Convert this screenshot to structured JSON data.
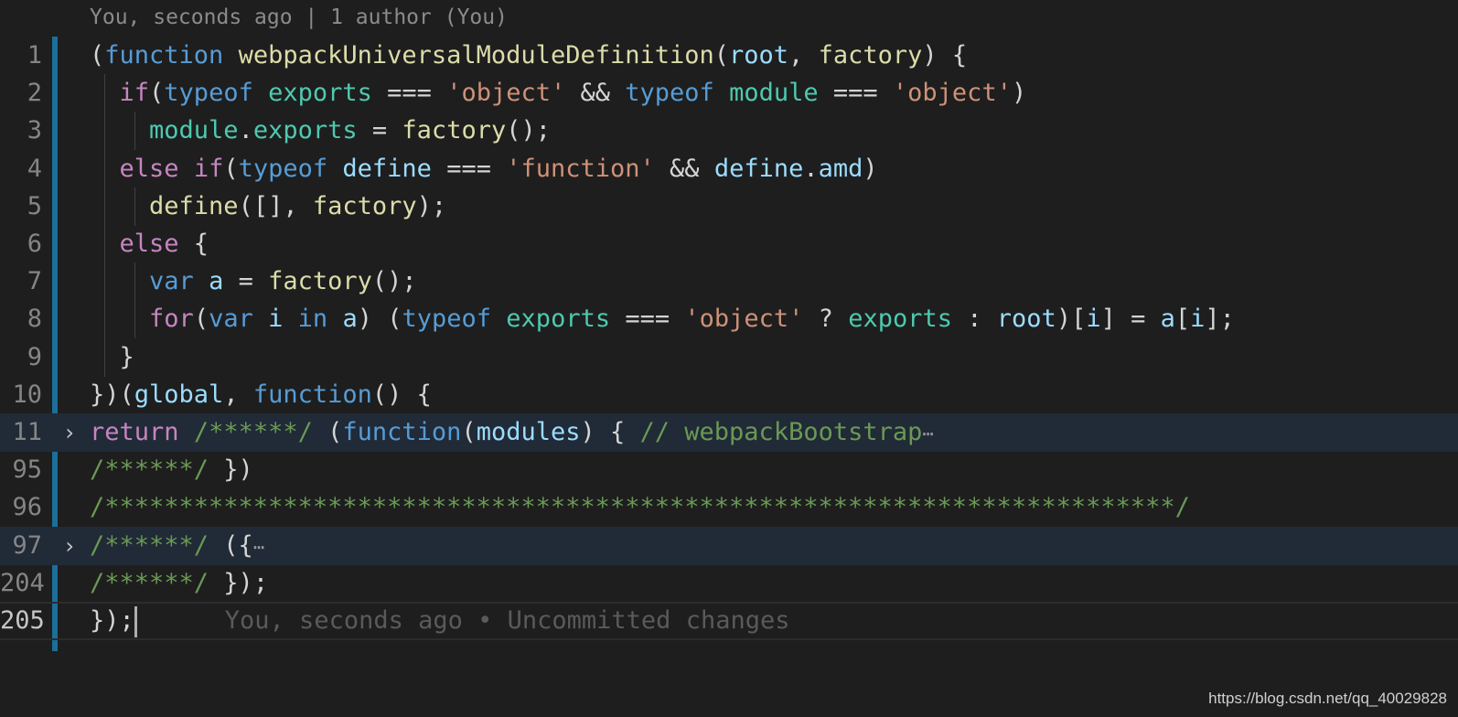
{
  "colors": {
    "background": "#1e1e1e",
    "keyword_blue": "#569cd6",
    "keyword_purple": "#c586c0",
    "function_yellow": "#dcdcaa",
    "variable_light": "#9cdcfe",
    "builtin_teal": "#4ec9b0",
    "string_orange": "#ce9178",
    "comment_green": "#6a9955",
    "default_text": "#d4d4d4",
    "gutter_modified": "#1b6f99"
  },
  "editor": {
    "blame_header": "You, seconds ago | 1 author (You)",
    "inline_blame": "You, seconds ago • Uncommitted changes",
    "watermark": "https://blog.csdn.net/qq_40029828"
  },
  "lines": [
    {
      "num": "1",
      "tokens": [
        {
          "t": "(",
          "c": "default_text"
        },
        {
          "t": "function",
          "c": "keyword_blue"
        },
        {
          "t": " ",
          "c": "default_text"
        },
        {
          "t": "webpackUniversalModuleDefinition",
          "c": "function_yellow"
        },
        {
          "t": "(",
          "c": "default_text"
        },
        {
          "t": "root",
          "c": "variable_light"
        },
        {
          "t": ", ",
          "c": "default_text"
        },
        {
          "t": "factory",
          "c": "function_yellow"
        },
        {
          "t": ") {",
          "c": "default_text"
        }
      ]
    },
    {
      "num": "2",
      "tokens": [
        {
          "t": "  ",
          "c": "default_text"
        },
        {
          "t": "if",
          "c": "keyword_purple"
        },
        {
          "t": "(",
          "c": "default_text"
        },
        {
          "t": "typeof",
          "c": "keyword_blue"
        },
        {
          "t": " ",
          "c": "default_text"
        },
        {
          "t": "exports",
          "c": "builtin_teal"
        },
        {
          "t": " === ",
          "c": "default_text"
        },
        {
          "t": "'object'",
          "c": "string_orange"
        },
        {
          "t": " && ",
          "c": "default_text"
        },
        {
          "t": "typeof",
          "c": "keyword_blue"
        },
        {
          "t": " ",
          "c": "default_text"
        },
        {
          "t": "module",
          "c": "builtin_teal"
        },
        {
          "t": " === ",
          "c": "default_text"
        },
        {
          "t": "'object'",
          "c": "string_orange"
        },
        {
          "t": ")",
          "c": "default_text"
        }
      ]
    },
    {
      "num": "3",
      "tokens": [
        {
          "t": "    ",
          "c": "default_text"
        },
        {
          "t": "module",
          "c": "builtin_teal"
        },
        {
          "t": ".",
          "c": "default_text"
        },
        {
          "t": "exports",
          "c": "builtin_teal"
        },
        {
          "t": " = ",
          "c": "default_text"
        },
        {
          "t": "factory",
          "c": "function_yellow"
        },
        {
          "t": "();",
          "c": "default_text"
        }
      ]
    },
    {
      "num": "4",
      "tokens": [
        {
          "t": "  ",
          "c": "default_text"
        },
        {
          "t": "else",
          "c": "keyword_purple"
        },
        {
          "t": " ",
          "c": "default_text"
        },
        {
          "t": "if",
          "c": "keyword_purple"
        },
        {
          "t": "(",
          "c": "default_text"
        },
        {
          "t": "typeof",
          "c": "keyword_blue"
        },
        {
          "t": " ",
          "c": "default_text"
        },
        {
          "t": "define",
          "c": "variable_light"
        },
        {
          "t": " === ",
          "c": "default_text"
        },
        {
          "t": "'function'",
          "c": "string_orange"
        },
        {
          "t": " && ",
          "c": "default_text"
        },
        {
          "t": "define",
          "c": "variable_light"
        },
        {
          "t": ".",
          "c": "default_text"
        },
        {
          "t": "amd",
          "c": "variable_light"
        },
        {
          "t": ")",
          "c": "default_text"
        }
      ]
    },
    {
      "num": "5",
      "tokens": [
        {
          "t": "    ",
          "c": "default_text"
        },
        {
          "t": "define",
          "c": "function_yellow"
        },
        {
          "t": "([], ",
          "c": "default_text"
        },
        {
          "t": "factory",
          "c": "function_yellow"
        },
        {
          "t": ");",
          "c": "default_text"
        }
      ]
    },
    {
      "num": "6",
      "tokens": [
        {
          "t": "  ",
          "c": "default_text"
        },
        {
          "t": "else",
          "c": "keyword_purple"
        },
        {
          "t": " {",
          "c": "default_text"
        }
      ]
    },
    {
      "num": "7",
      "tokens": [
        {
          "t": "    ",
          "c": "default_text"
        },
        {
          "t": "var",
          "c": "keyword_blue"
        },
        {
          "t": " ",
          "c": "default_text"
        },
        {
          "t": "a",
          "c": "variable_light"
        },
        {
          "t": " = ",
          "c": "default_text"
        },
        {
          "t": "factory",
          "c": "function_yellow"
        },
        {
          "t": "();",
          "c": "default_text"
        }
      ]
    },
    {
      "num": "8",
      "tokens": [
        {
          "t": "    ",
          "c": "default_text"
        },
        {
          "t": "for",
          "c": "keyword_purple"
        },
        {
          "t": "(",
          "c": "default_text"
        },
        {
          "t": "var",
          "c": "keyword_blue"
        },
        {
          "t": " ",
          "c": "default_text"
        },
        {
          "t": "i",
          "c": "variable_light"
        },
        {
          "t": " ",
          "c": "default_text"
        },
        {
          "t": "in",
          "c": "keyword_blue"
        },
        {
          "t": " ",
          "c": "default_text"
        },
        {
          "t": "a",
          "c": "variable_light"
        },
        {
          "t": ") (",
          "c": "default_text"
        },
        {
          "t": "typeof",
          "c": "keyword_blue"
        },
        {
          "t": " ",
          "c": "default_text"
        },
        {
          "t": "exports",
          "c": "builtin_teal"
        },
        {
          "t": " === ",
          "c": "default_text"
        },
        {
          "t": "'object'",
          "c": "string_orange"
        },
        {
          "t": " ? ",
          "c": "default_text"
        },
        {
          "t": "exports",
          "c": "builtin_teal"
        },
        {
          "t": " : ",
          "c": "default_text"
        },
        {
          "t": "root",
          "c": "variable_light"
        },
        {
          "t": ")[",
          "c": "default_text"
        },
        {
          "t": "i",
          "c": "variable_light"
        },
        {
          "t": "] = ",
          "c": "default_text"
        },
        {
          "t": "a",
          "c": "variable_light"
        },
        {
          "t": "[",
          "c": "default_text"
        },
        {
          "t": "i",
          "c": "variable_light"
        },
        {
          "t": "];",
          "c": "default_text"
        }
      ]
    },
    {
      "num": "9",
      "tokens": [
        {
          "t": "  }",
          "c": "default_text"
        }
      ]
    },
    {
      "num": "10",
      "tokens": [
        {
          "t": "})(",
          "c": "default_text"
        },
        {
          "t": "global",
          "c": "variable_light"
        },
        {
          "t": ", ",
          "c": "default_text"
        },
        {
          "t": "function",
          "c": "keyword_blue"
        },
        {
          "t": "() {",
          "c": "default_text"
        }
      ]
    },
    {
      "num": "11",
      "folded": true,
      "tokens": [
        {
          "t": "return",
          "c": "keyword_purple"
        },
        {
          "t": " ",
          "c": "default_text"
        },
        {
          "t": "/******/",
          "c": "comment_green"
        },
        {
          "t": " (",
          "c": "default_text"
        },
        {
          "t": "function",
          "c": "keyword_blue"
        },
        {
          "t": "(",
          "c": "default_text"
        },
        {
          "t": "modules",
          "c": "variable_light"
        },
        {
          "t": ") { ",
          "c": "default_text"
        },
        {
          "t": "// webpackBootstrap",
          "c": "comment_green"
        }
      ]
    },
    {
      "num": "95",
      "tokens": [
        {
          "t": "/******/",
          "c": "comment_green"
        },
        {
          "t": " })",
          "c": "default_text"
        }
      ]
    },
    {
      "num": "96",
      "tokens": [
        {
          "t": "/************************************************************************/",
          "c": "comment_green"
        }
      ]
    },
    {
      "num": "97",
      "folded": true,
      "tokens": [
        {
          "t": "/******/",
          "c": "comment_green"
        },
        {
          "t": " ({",
          "c": "default_text"
        }
      ]
    },
    {
      "num": "204",
      "tokens": [
        {
          "t": "/******/",
          "c": "comment_green"
        },
        {
          "t": " });",
          "c": "default_text"
        }
      ]
    },
    {
      "num": "205",
      "current": true,
      "tokens": [
        {
          "t": "});",
          "c": "default_text"
        }
      ]
    }
  ]
}
